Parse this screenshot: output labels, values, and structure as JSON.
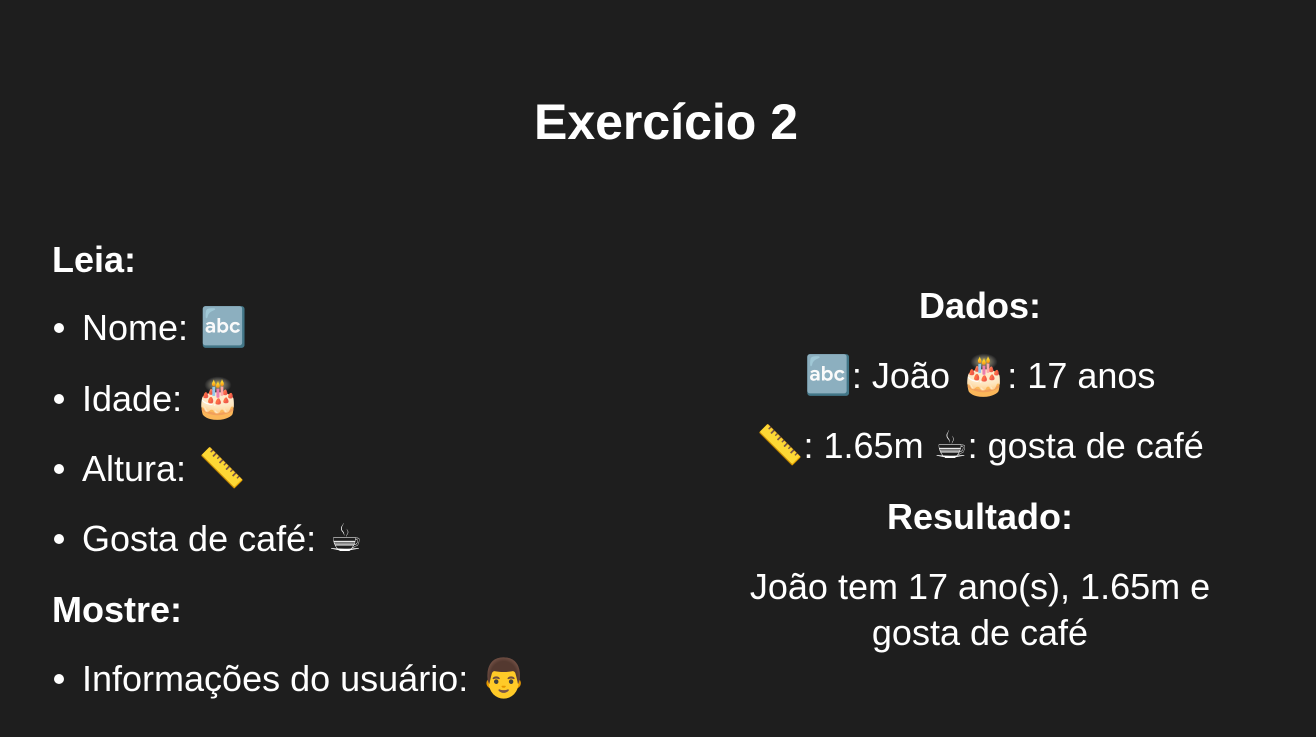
{
  "title": "Exercício 2",
  "left": {
    "read_heading": "Leia:",
    "read_items": [
      {
        "label": "Nome:",
        "icon": "abc-icon",
        "emoji": "🔤"
      },
      {
        "label": "Idade:",
        "icon": "birthday-cake-icon",
        "emoji": "🎂"
      },
      {
        "label": "Altura:",
        "icon": "ruler-icon",
        "emoji": "📏"
      },
      {
        "label": "Gosta de café:",
        "icon": "coffee-icon",
        "emoji": "☕"
      }
    ],
    "show_heading": "Mostre:",
    "show_items": [
      {
        "label": "Informações do usuário:",
        "icon": "man-icon",
        "emoji": "👨"
      }
    ]
  },
  "right": {
    "data_heading": "Dados:",
    "line1": {
      "emoji1": "🔤",
      "text1": ": João ",
      "emoji2": "🎂",
      "text2": ": 17 anos"
    },
    "line2": {
      "emoji1": "📏",
      "text1": ": 1.65m ",
      "emoji2": "☕",
      "text2": ": gosta de café"
    },
    "result_heading": "Resultado:",
    "result_line1": "João tem 17 ano(s), 1.65m e",
    "result_line2": "gosta de café"
  }
}
